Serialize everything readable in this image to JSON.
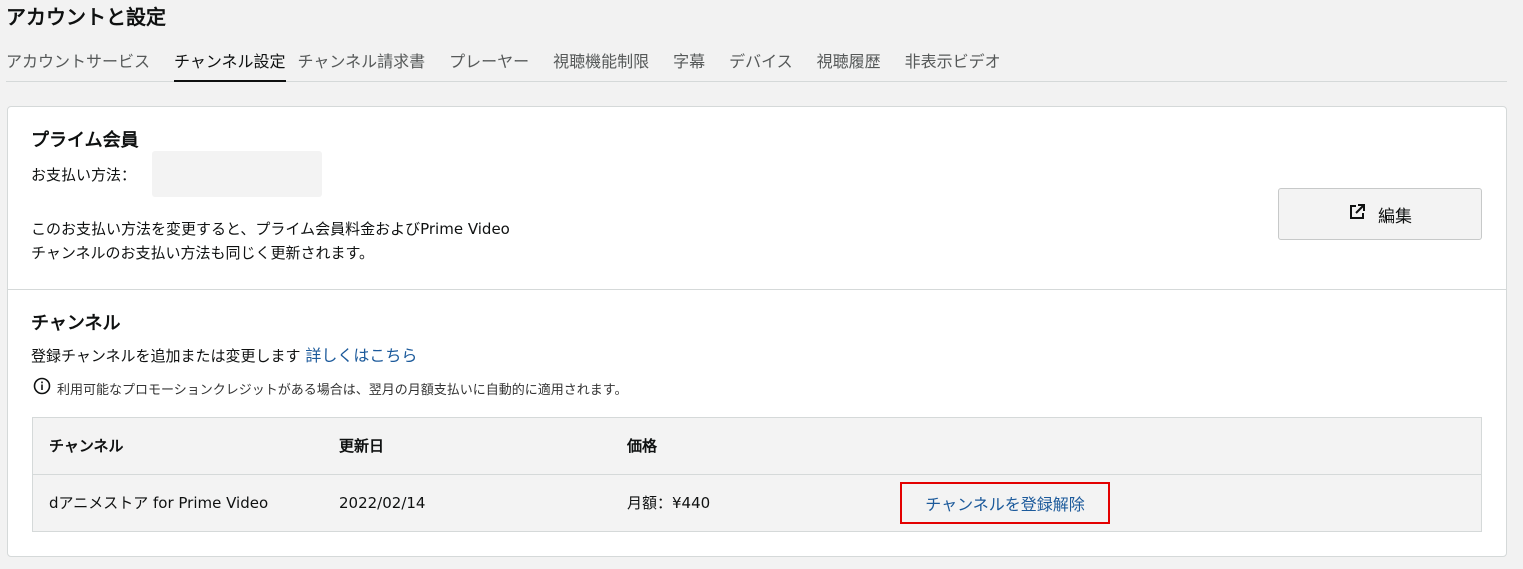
{
  "page_title": "アカウントと設定",
  "tabs": [
    {
      "label": "アカウントサービス",
      "active": false
    },
    {
      "label": "チャンネル設定",
      "active": true
    },
    {
      "label": "チャンネル請求書",
      "active": false
    },
    {
      "label": "プレーヤー",
      "active": false
    },
    {
      "label": "視聴機能制限",
      "active": false
    },
    {
      "label": "字幕",
      "active": false
    },
    {
      "label": "デバイス",
      "active": false
    },
    {
      "label": "視聴履歴",
      "active": false
    },
    {
      "label": "非表示ビデオ",
      "active": false
    }
  ],
  "prime": {
    "heading": "プライム会員",
    "payment_label": "お支払い方法：",
    "note_line1": "このお支払い方法を変更すると、プライム会員料金およびPrime Video",
    "note_line2": "チャンネルのお支払い方法も同じく更新されます。",
    "edit_label": "編集"
  },
  "channels": {
    "heading": "チャンネル",
    "desc": "登録チャンネルを追加または変更します",
    "learn_more": "詳しくはこちら",
    "info": "利用可能なプロモーションクレジットがある場合は、翌月の月額支払いに自動的に適用されます。",
    "table": {
      "headers": [
        "チャンネル",
        "更新日",
        "価格"
      ],
      "rows": [
        {
          "channel": "dアニメストア for Prime Video",
          "renewal": "2022/02/14",
          "price": "月額：¥440",
          "action": "チャンネルを登録解除"
        }
      ]
    }
  },
  "colors": {
    "link": "#1c5a9b",
    "highlight": "#e30000"
  }
}
